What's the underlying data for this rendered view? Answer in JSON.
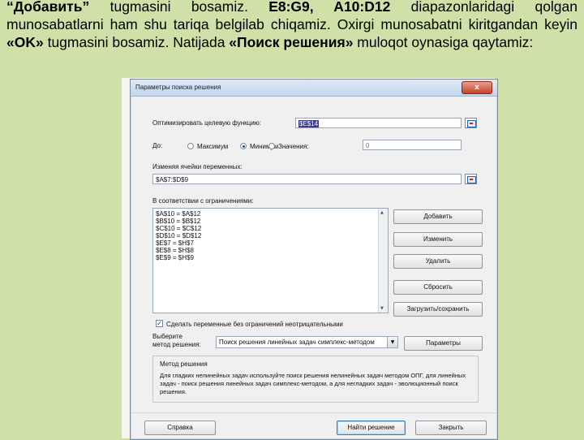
{
  "slide": {
    "t1": "“Добавить”",
    "t2": " tugmasini bosamiz. ",
    "t3": "E8:G9, A10:D12",
    "t4": "  diapazonlaridagi qolgan munosabatlarni ham shu tariqa belgilab chiqamiz. Oxirgi munosabatni kiritgandan keyin ",
    "t5": "«OK»",
    "t6": " tugmasini bosamiz.  Natijada ",
    "t7": "«Поиск решения»",
    "t8": " muloqot oynasiga qaytamiz:"
  },
  "dialog": {
    "title": "Параметры поиска решения",
    "close_glyph": "x",
    "objective_label": "Оптимизировать целевую функцию:",
    "objective_value": "$E$14",
    "to_label": "До:",
    "radio_max": "Максимум",
    "radio_min": "Минимум",
    "radio_value": "Значения:",
    "value_field": "0",
    "selected_option": "Минимум",
    "variables_label": "Изменяя ячейки переменных:",
    "variables_value": "$A$7:$D$9",
    "constraints_label": "В соответствии с ограничениями:",
    "constraints": [
      "$A$10 = $A$12",
      "$B$10 = $B$12",
      "$C$10 = $C$12",
      "$D$10 = $D$12",
      "$E$7 = $H$7",
      "$E$8 = $H$8",
      "$E$9 = $H$9"
    ],
    "btn_add": "Добавить",
    "btn_change": "Изменить",
    "btn_delete": "Удалить",
    "btn_reset": "Сбросить",
    "btn_load_save": "Загрузить/сохранить",
    "nonneg_checked": true,
    "nonneg_label": "Сделать переменные без ограничений неотрицательными",
    "method_label_1": "Выберите",
    "method_label_2": "метод решения:",
    "method_value": "Поиск решения линейных задач симплекс-методом",
    "btn_params": "Параметры",
    "group_title": "Метод решения",
    "group_desc": "Для гладких нелинейных задач используйте поиск решения нелинейных задач методом ОПГ, для линейных задач - поиск решения линейных задач симплекс-методом, а для негладких задач - эволюционный поиск решения.",
    "btn_help": "Справка",
    "btn_solve": "Найти решение",
    "btn_close": "Закрыть"
  },
  "icons": {
    "ref_icon": "range-selector-icon",
    "checkbox_glyph": "✓",
    "scroll_up": "▲",
    "scroll_down": "▼",
    "combo_arrow": "▼"
  },
  "colors": {
    "slide_background": "#cfe0a8",
    "titlebar": "#c3d6ec",
    "close_button": "#c5402a"
  }
}
